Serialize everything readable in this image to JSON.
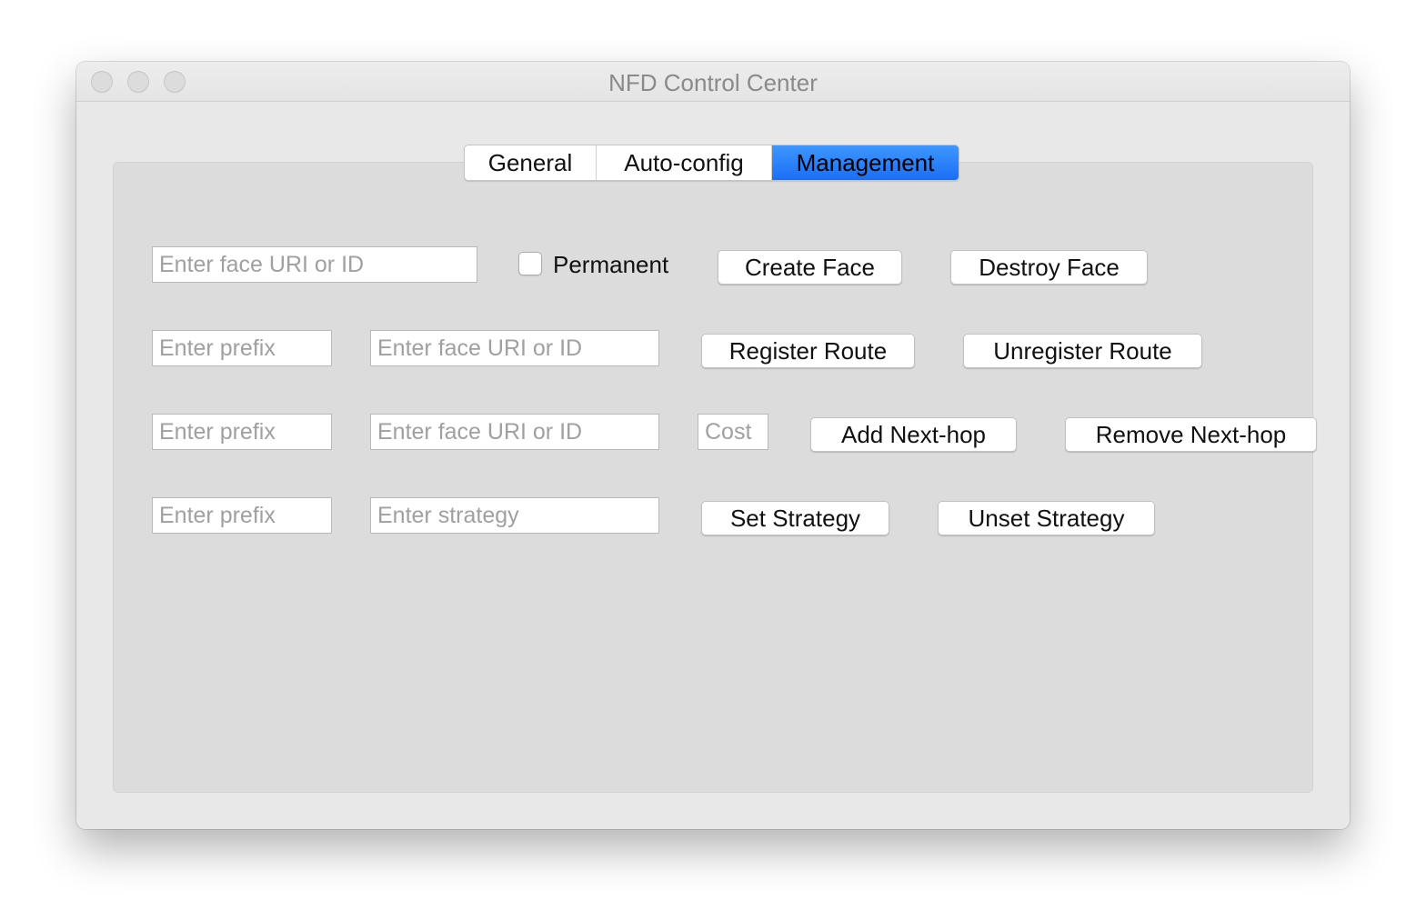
{
  "window": {
    "title": "NFD Control Center"
  },
  "tabs": [
    {
      "label": "General",
      "active": false
    },
    {
      "label": "Auto-config",
      "active": false
    },
    {
      "label": "Management",
      "active": true
    }
  ],
  "accent_color": "#1b6ef5",
  "face_row": {
    "face_placeholder": "Enter face URI or ID",
    "permanent_label": "Permanent",
    "permanent_checked": false,
    "create_label": "Create Face",
    "destroy_label": "Destroy Face"
  },
  "route_row": {
    "prefix_placeholder": "Enter prefix",
    "face_placeholder": "Enter face URI or ID",
    "register_label": "Register Route",
    "unregister_label": "Unregister Route"
  },
  "nexthop_row": {
    "prefix_placeholder": "Enter prefix",
    "face_placeholder": "Enter face URI or ID",
    "cost_placeholder": "Cost",
    "add_label": "Add Next-hop",
    "remove_label": "Remove Next-hop"
  },
  "strategy_row": {
    "prefix_placeholder": "Enter prefix",
    "strategy_placeholder": "Enter strategy",
    "set_label": "Set Strategy",
    "unset_label": "Unset Strategy"
  }
}
